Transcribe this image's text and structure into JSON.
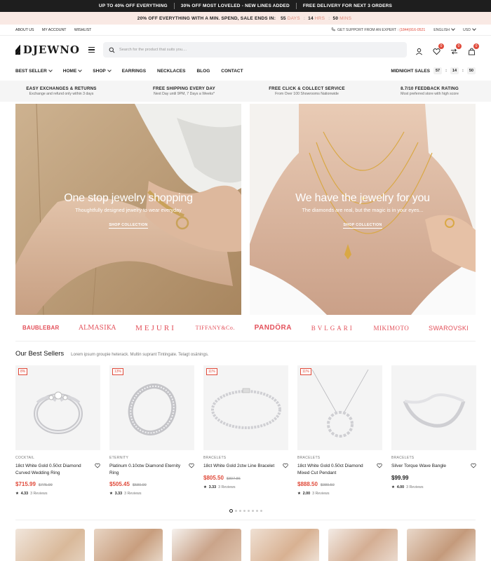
{
  "topbar": {
    "items": [
      "UP TO 40% OFF EVERYTHING",
      "30% OFF MOST LOVELED - NEW LINES ADDED",
      "FREE DELIVERY FOR NEXT 3 ORDERS"
    ]
  },
  "promo": {
    "text": "20% OFF EVERYTHING WITH A MIN. SPEND, SALE ENDS IN:",
    "days": "55",
    "days_unit": "DAYS",
    "hrs": "14",
    "hrs_unit": "HRS",
    "mins": "50",
    "mins_unit": "MINS"
  },
  "util": {
    "links": [
      "ABOUT US",
      "MY ACCOUNT",
      "WISHLIST"
    ],
    "support": "GET SUPPORT FROM AN EXPERT :",
    "phone": "(1844)916-0521",
    "language": "ENGLISH",
    "currency": "USD"
  },
  "header": {
    "brand": "DJEWNO",
    "search_placeholder": "Search for the product that suits you....",
    "wishlist_count": "0",
    "compare_count": "0",
    "cart_count": "0"
  },
  "nav": {
    "items": [
      "BEST SELLER",
      "HOME",
      "SHOP",
      "EARRINGS",
      "NECKLACES",
      "BLOG",
      "CONTACT"
    ],
    "midnight_label": "MIDNIGHT SALES",
    "t1": "57",
    "t2": "14",
    "t3": "50"
  },
  "features": [
    {
      "title": "EASY EXCHANGES & RETURNS",
      "sub": "Exchange and refund only within 3 days"
    },
    {
      "title": "FREE SHIPPING EVERY DAY",
      "sub": "Next Day until 9PM, 7 Days a Weeks*"
    },
    {
      "title": "FREE CLICK & COLLECT SERVICE",
      "sub": "From Over 100 Showrooms Nationwide"
    },
    {
      "title": "8.7/10 FEEDBACK RATING",
      "sub": "Most preferred store with high score"
    }
  ],
  "heroes": [
    {
      "title": "One stop jewelry shopping",
      "sub": "Thoughtfully designed jewelry to wear everyday",
      "cta": "SHOP COLLECTION"
    },
    {
      "title": "We have the jewelry for you",
      "sub": "The diamonds are real, but the magic is in your eyes...",
      "cta": "SHOP COLLECTION"
    }
  ],
  "brands": [
    "BAUBLEBAR",
    "ALMASIKA",
    "MEJURI",
    "TIFFANY&Co.",
    "PANDÖRA",
    "BVLGARI",
    "MIKIMOTO",
    "SWAROVSKI"
  ],
  "best_sellers": {
    "title": "Our Best Sellers",
    "subtitle": "Lorem ipsum groupie heterack. Multin suprant Tintingate. Telagt osänings.",
    "products": [
      {
        "badge": "8%",
        "category": "COCKTAIL",
        "name": "18ct White Gold 0.50ct Diamond Curved Wedding Ring",
        "price": "$715.99",
        "old": "$775.99",
        "rating": "4.33",
        "reviews": "3 Reviews"
      },
      {
        "badge": "13%",
        "category": "ETERNITY",
        "name": "Platinum 0.10ctw Diamond Eternity Ring",
        "price": "$505.45",
        "old": "$580.99",
        "rating": "3.33",
        "reviews": "3 Reviews"
      },
      {
        "badge": "11%",
        "category": "BRACELETS",
        "name": "18ct White Gold 2ctw Line Bracelet",
        "price": "$805.50",
        "old": "$897.86",
        "rating": "3.33",
        "reviews": "3 Reviews"
      },
      {
        "badge": "11%",
        "category": "BRACELETS",
        "name": "18ct White Gold 0.50ct Diamond Mixed Cut Pendant",
        "price": "$888.50",
        "old": "$989.50",
        "rating": "2.00",
        "reviews": "3 Reviews"
      },
      {
        "badge": "",
        "category": "BRACELETS",
        "name": "Silver Torque Wave Bangle",
        "price": "$99.99",
        "old": "",
        "rating": "4.00",
        "reviews": "3 Reviews"
      }
    ]
  },
  "colors": {
    "accent": "#e04a3a",
    "brand_logo": "#e3505a",
    "topbar": "#1e1e1e",
    "promo_bg": "#f9e9e4"
  }
}
